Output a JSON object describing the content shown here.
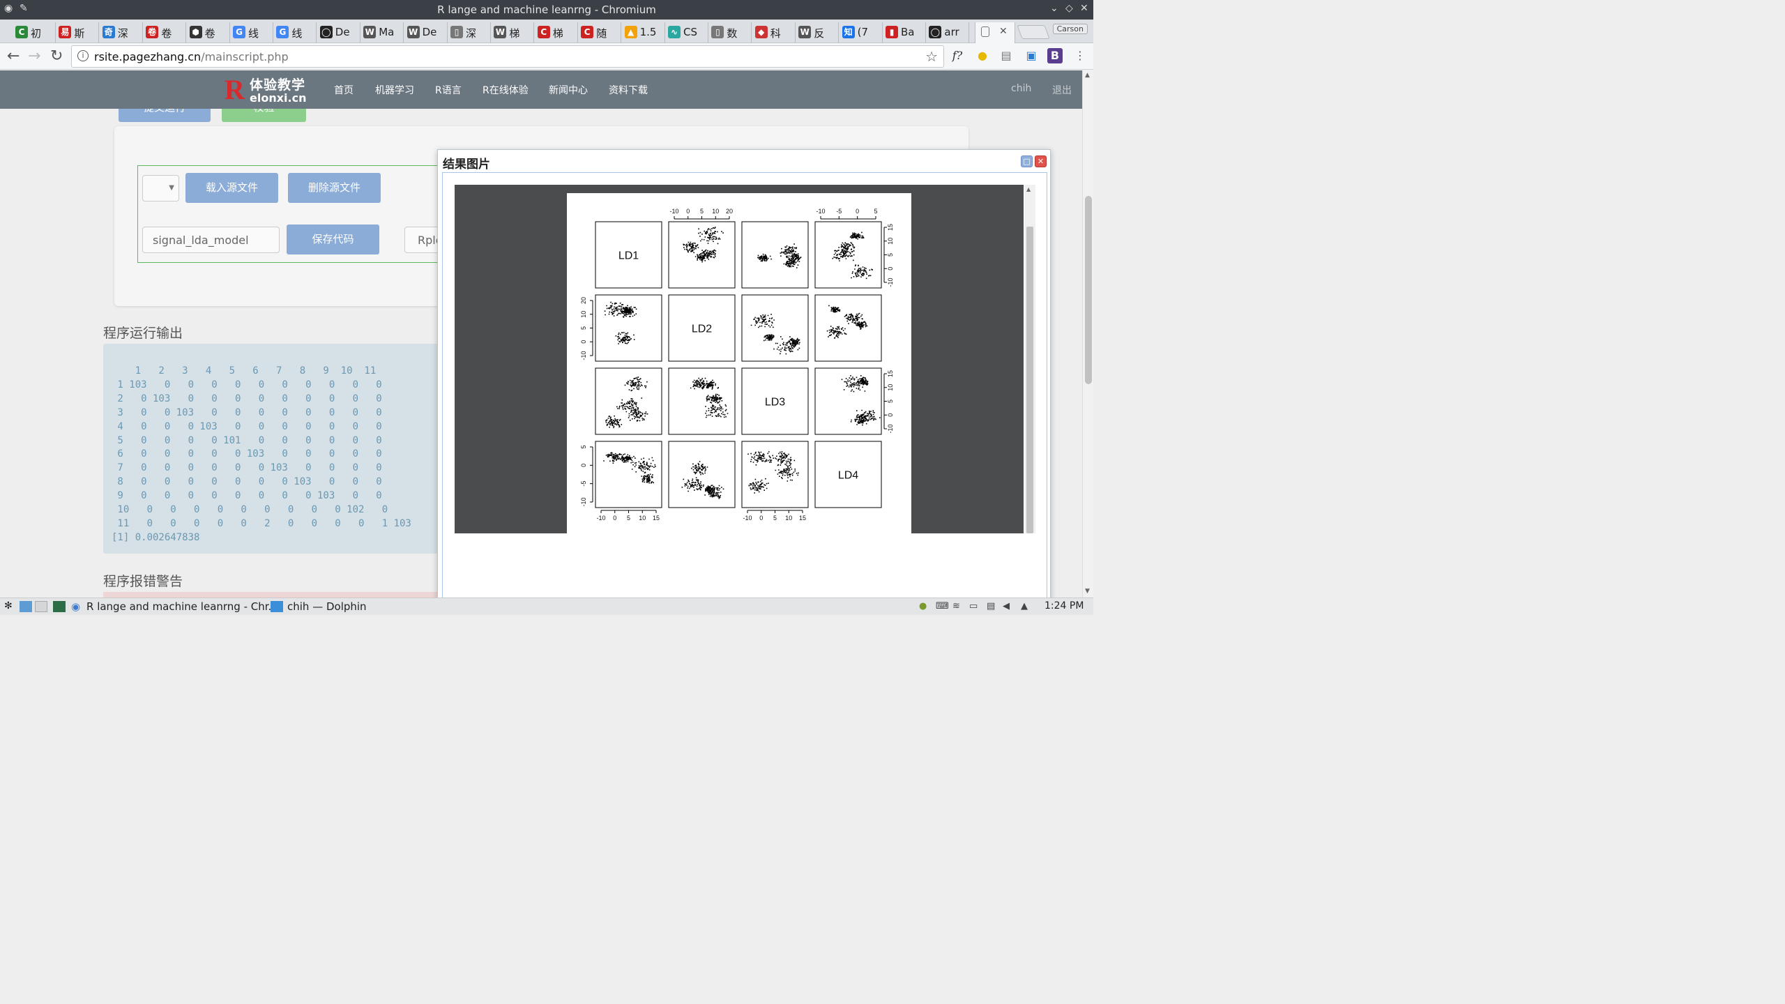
{
  "window": {
    "title": "R lange and machine leanrng - Chromium"
  },
  "tabs": [
    {
      "label": "初"
    },
    {
      "label": "斯"
    },
    {
      "label": "深"
    },
    {
      "label": "卷"
    },
    {
      "label": "卷"
    },
    {
      "label": "线"
    },
    {
      "label": "线"
    },
    {
      "label": "De"
    },
    {
      "label": "Ma"
    },
    {
      "label": "De"
    },
    {
      "label": "深"
    },
    {
      "label": "梯"
    },
    {
      "label": "梯"
    },
    {
      "label": "随"
    },
    {
      "label": "1.5"
    },
    {
      "label": "CS"
    },
    {
      "label": "数"
    },
    {
      "label": "科"
    },
    {
      "label": "反"
    },
    {
      "label": "(7"
    },
    {
      "label": "Ba"
    },
    {
      "label": "arr"
    }
  ],
  "profile": "Carson",
  "omnibox": {
    "host": "rsite.pagezhang.cn",
    "path": "/mainscript.php"
  },
  "site": {
    "logo_cn": "体验教学",
    "logo_en": "elonxi.cn",
    "menu": [
      "首页",
      "机器学习",
      "R语言",
      "R在线体验",
      "新闻中心",
      "资料下载"
    ],
    "user": "chih",
    "logout": "退出"
  },
  "form": {
    "submit_label": "提交运行",
    "confirm_label": "校验",
    "load_label": "载入源文件",
    "delete_label": "删除源文件",
    "name_value": "signal_lda_model",
    "save_label": "保存代码",
    "rplot_value": "Rplot"
  },
  "output": {
    "heading": "程序运行输出",
    "text": "    1   2   3   4   5   6   7   8   9  10  11\n 1 103   0   0   0   0   0   0   0   0   0   0\n 2   0 103   0   0   0   0   0   0   0   0   0\n 3   0   0 103   0   0   0   0   0   0   0   0\n 4   0   0   0 103   0   0   0   0   0   0   0\n 5   0   0   0   0 101   0   0   0   0   0   0\n 6   0   0   0   0   0 103   0   0   0   0   0\n 7   0   0   0   0   0   0 103   0   0   0   0\n 8   0   0   0   0   0   0   0 103   0   0   0\n 9   0   0   0   0   0   0   0   0 103   0   0\n 10   0   0   0   0   0   0   0   0   0 102   0\n 11   0   0   0   0   0   2   0   0   0   0   1 103\n[1] 0.002647838"
  },
  "errors": {
    "heading": "程序报错警告"
  },
  "modal": {
    "title": "结果图片",
    "diagonal_labels": [
      "LD1",
      "LD2",
      "LD3",
      "LD4"
    ],
    "top_axis_col2": [
      "-10",
      "0",
      "5",
      "10",
      "20"
    ],
    "top_axis_col4": [
      "-10",
      "-5",
      "0",
      "5"
    ],
    "right_axis_row1": [
      "15",
      "10",
      "5",
      "0",
      "-10"
    ],
    "right_axis_row3": [
      "15",
      "10",
      "5",
      "0",
      "-10"
    ],
    "left_axis_row2": [
      "20",
      "10",
      "5",
      "0",
      "-10"
    ],
    "left_axis_row4": [
      "5",
      "0",
      "-5",
      "-10"
    ],
    "bottom_axis_col1": [
      "-10",
      "0",
      "5",
      "10",
      "15"
    ],
    "bottom_axis_col3": [
      "-10",
      "0",
      "5",
      "10",
      "15"
    ]
  },
  "taskbar": {
    "item1": "R lange and machine leanrng - Chr...",
    "item2": "chih — Dolphin",
    "clock": "1:24 PM"
  },
  "colors": {
    "accent_button": "#8bacd7",
    "navbar": "#6b7780",
    "green_border": "#5cb85c",
    "output_text": "#6a98b3"
  }
}
